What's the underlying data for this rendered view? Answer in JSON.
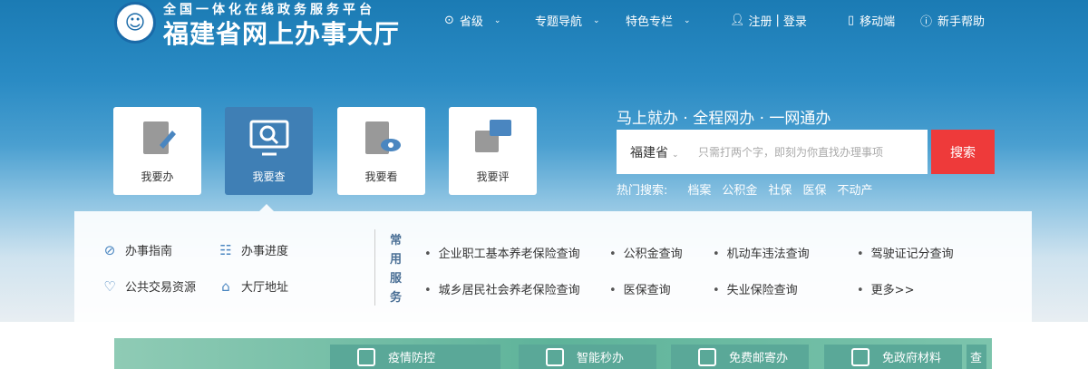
{
  "header": {
    "subtitle": "全国一体化在线政务服务平台",
    "title": "福建省网上办事大厅",
    "nav": [
      {
        "label": "省级",
        "icon": "location-icon"
      },
      {
        "label": "专题导航"
      },
      {
        "label": "特色专栏"
      }
    ],
    "user": {
      "register": "注册",
      "sep": "|",
      "login": "登录"
    },
    "mobile": "移动端",
    "help": "新手帮助"
  },
  "tiles": [
    {
      "label": "我要办",
      "icon": "edit-doc-icon"
    },
    {
      "label": "我要查",
      "icon": "monitor-search-icon"
    },
    {
      "label": "我要看",
      "icon": "doc-eye-icon"
    },
    {
      "label": "我要评",
      "icon": "comment-icon"
    }
  ],
  "search": {
    "slogan": "马上就办 · 全程网办 · 一网通办",
    "province": "福建省",
    "placeholder": "只需打两个字，即刻为你直找办理事项",
    "button": "搜索",
    "hot_label": "热门搜索:",
    "hot": [
      "档案",
      "公积金",
      "社保",
      "医保",
      "不动产"
    ]
  },
  "quick": [
    "办事指南",
    "办事进度",
    "公共交易资源",
    "大厅地址"
  ],
  "common": {
    "title": "常用服务",
    "items": [
      "企业职工基本养老保险查询",
      "公积金查询",
      "机动车违法查询",
      "驾驶证记分查询",
      "城乡居民社会养老保险查询",
      "医保查询",
      "失业保险查询",
      "更多>>"
    ]
  },
  "bottom": [
    "疫情防控",
    "智能秒办",
    "免费邮寄办",
    "免政府材料",
    "查"
  ],
  "colors": {
    "primary": "#1b7bb4",
    "search_button": "#ee3a3a",
    "active_tile": "#3f7fb5"
  }
}
